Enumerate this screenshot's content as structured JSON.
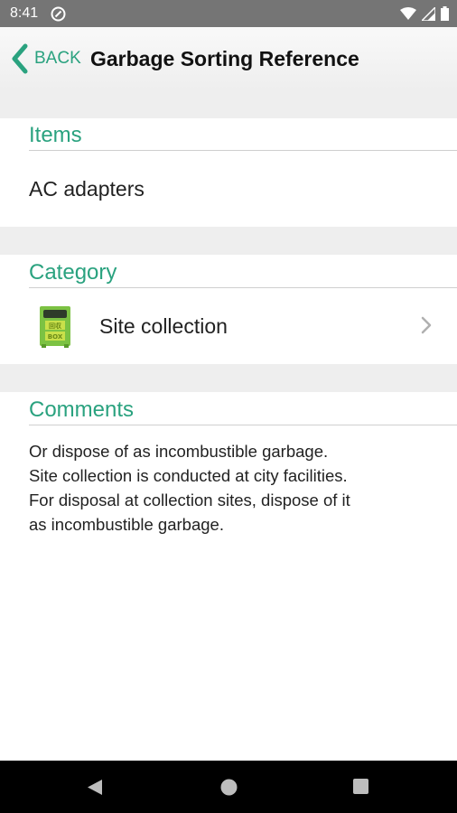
{
  "status": {
    "time": "8:41"
  },
  "header": {
    "back_label": "BACK",
    "title": "Garbage Sorting Reference"
  },
  "sections": {
    "items": {
      "heading": "Items",
      "value": "AC adapters"
    },
    "category": {
      "heading": "Category",
      "value": "Site collection",
      "icon_text_top": "回収",
      "icon_text_bottom": "BOX"
    },
    "comments": {
      "heading": "Comments",
      "lines": [
        "Or dispose of as incombustible garbage.",
        "Site collection is conducted at city facilities.",
        "For disposal at collection sites, dispose of it",
        "as incombustible garbage."
      ]
    }
  },
  "colors": {
    "accent": "#2aa27f",
    "status_bar": "#757575",
    "nav_bar": "#000000",
    "band": "#eeeeee"
  },
  "icons": {
    "back": "chevron-left-icon",
    "category_row": "chevron-right-icon",
    "nav": [
      "back-triangle-icon",
      "home-circle-icon",
      "recents-square-icon"
    ]
  }
}
